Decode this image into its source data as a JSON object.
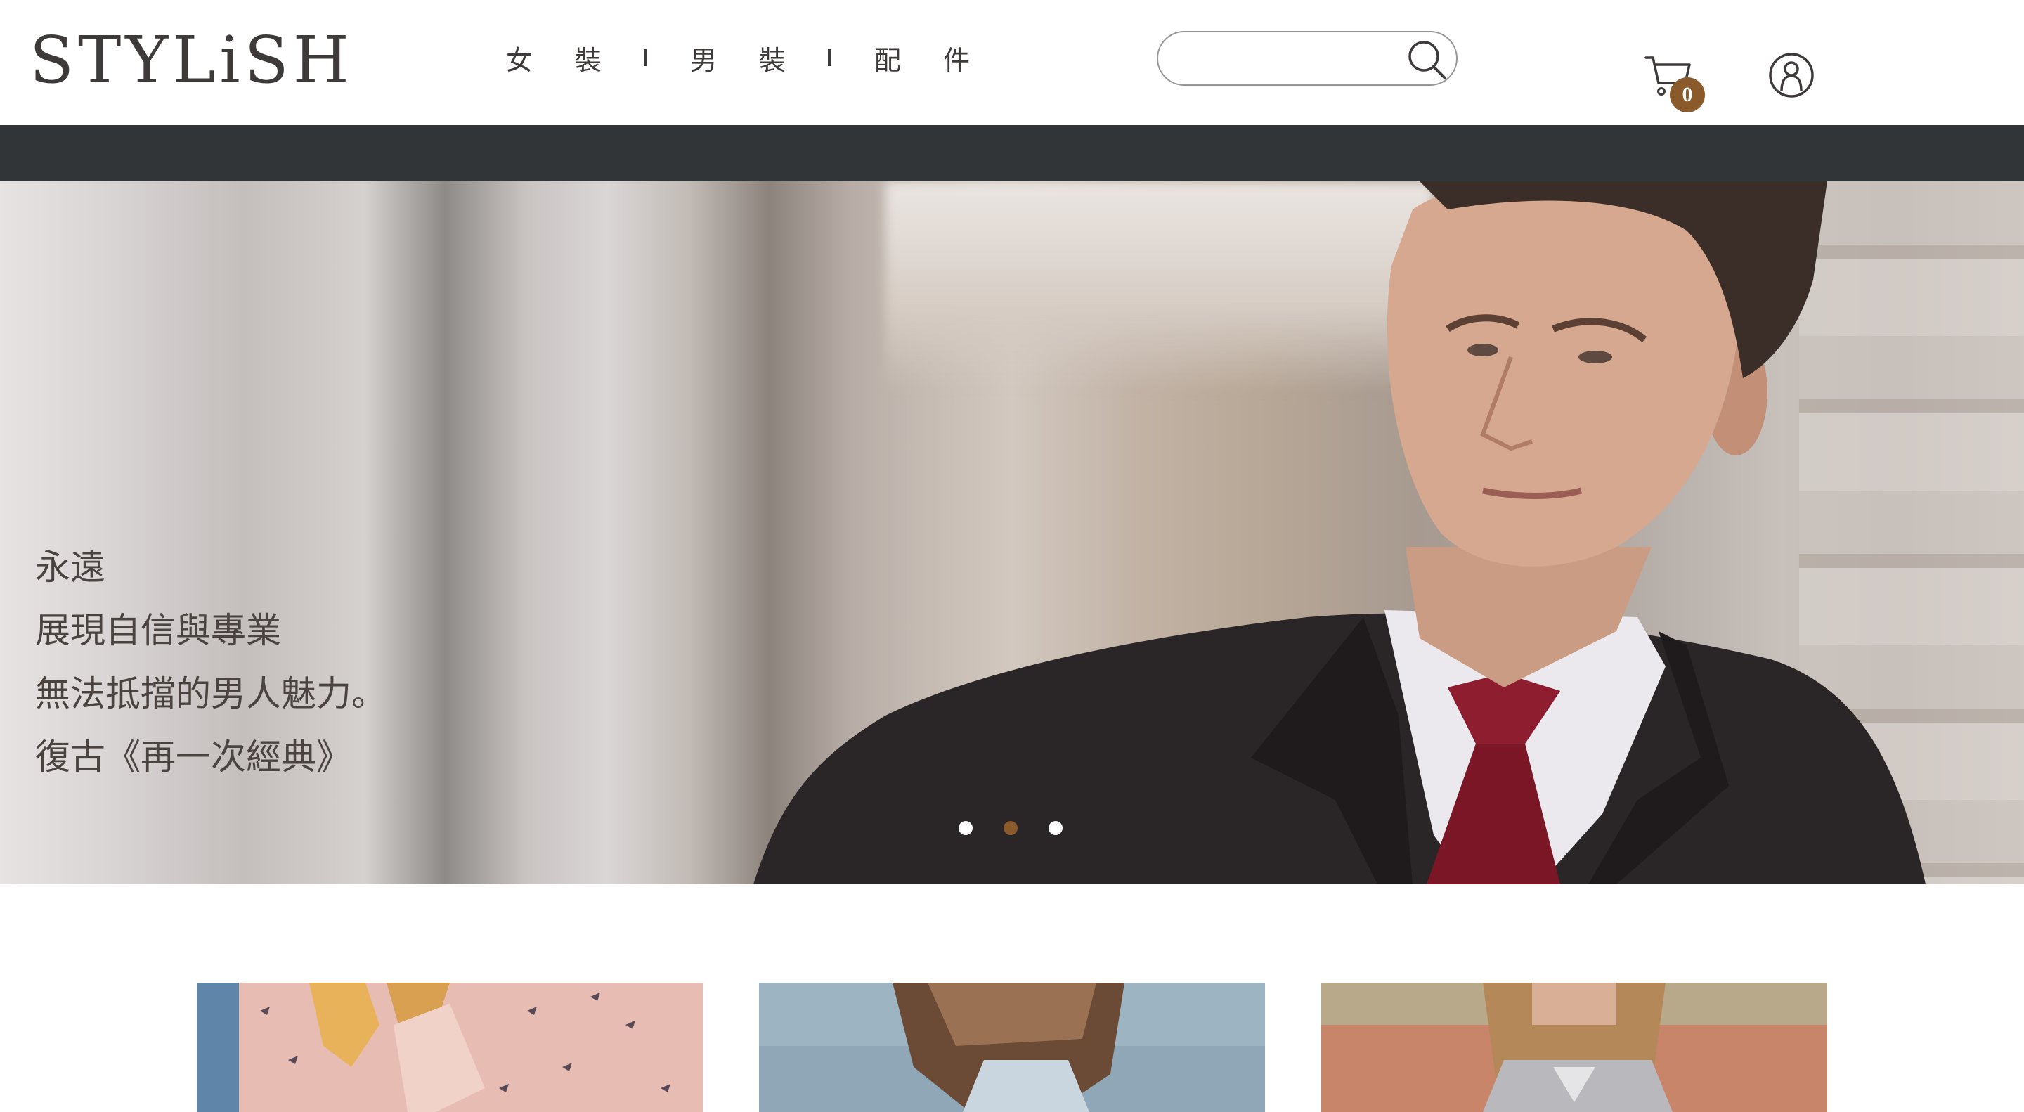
{
  "header": {
    "logo": "STYLiSH",
    "nav": [
      {
        "label": "女裝"
      },
      {
        "label": "男裝"
      },
      {
        "label": "配件"
      }
    ],
    "search": {
      "value": "",
      "placeholder": ""
    },
    "cart_count": "0",
    "icons": {
      "search": "search-icon",
      "cart": "cart-icon",
      "member": "member-icon"
    }
  },
  "hero": {
    "lines": [
      "永遠",
      "展現自信與專業",
      "無法抵擋的男人魅力。",
      "復古《再一次經典》"
    ],
    "dots_count": 3,
    "active_dot": 1
  },
  "colors": {
    "text": "#3f3a3a",
    "accent": "#8b5a2b",
    "dark_bar": "#313538"
  }
}
